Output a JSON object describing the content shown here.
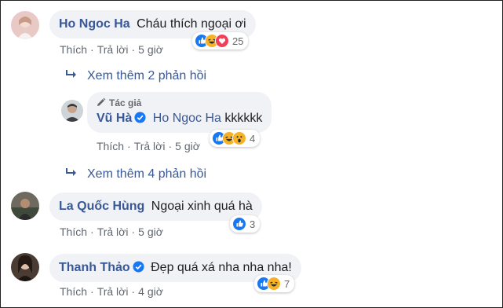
{
  "colors": {
    "link": "#385898",
    "bubble": "#f0f2f5",
    "meta": "#606770",
    "like": "#1877f2",
    "love": "#f33e58",
    "haha": "#f7b125"
  },
  "comments": [
    {
      "author": "Ho Ngoc Ha",
      "text": "Cháu thích ngoại ơi",
      "reactions": {
        "icons": [
          "like-icon",
          "haha-icon",
          "love-icon"
        ],
        "count": "25"
      },
      "actions": {
        "like": "Thích",
        "reply": "Trả lời",
        "time": "5 giờ"
      }
    },
    {
      "author": "La Quốc Hùng",
      "text": "Ngoại xinh quá hà",
      "reactions": {
        "icons": [
          "like-icon"
        ],
        "count": "3"
      },
      "actions": {
        "like": "Thích",
        "reply": "Trả lời",
        "time": "5 giờ"
      }
    },
    {
      "author": "Thanh Thảo",
      "text": "Đẹp quá xá nha nha nha!",
      "reactions": {
        "icons": [
          "like-icon",
          "haha-icon"
        ],
        "count": "7"
      },
      "actions": {
        "like": "Thích",
        "reply": "Trả lời",
        "time": "4 giờ"
      }
    }
  ],
  "replies_link_1": "Xem thêm 2 phản hồi",
  "replies_link_2": "Xem thêm 4 phản hồi",
  "reply": {
    "tag": "Tác giả",
    "author": "Vũ Hà",
    "mention": "Ho Ngoc Ha",
    "text": "kkkkkk",
    "reactions": {
      "icons": [
        "like-icon",
        "haha-icon",
        "wow-icon"
      ],
      "count": "4"
    },
    "actions": {
      "like": "Thích",
      "reply": "Trả lời",
      "time": "5 giờ"
    }
  }
}
